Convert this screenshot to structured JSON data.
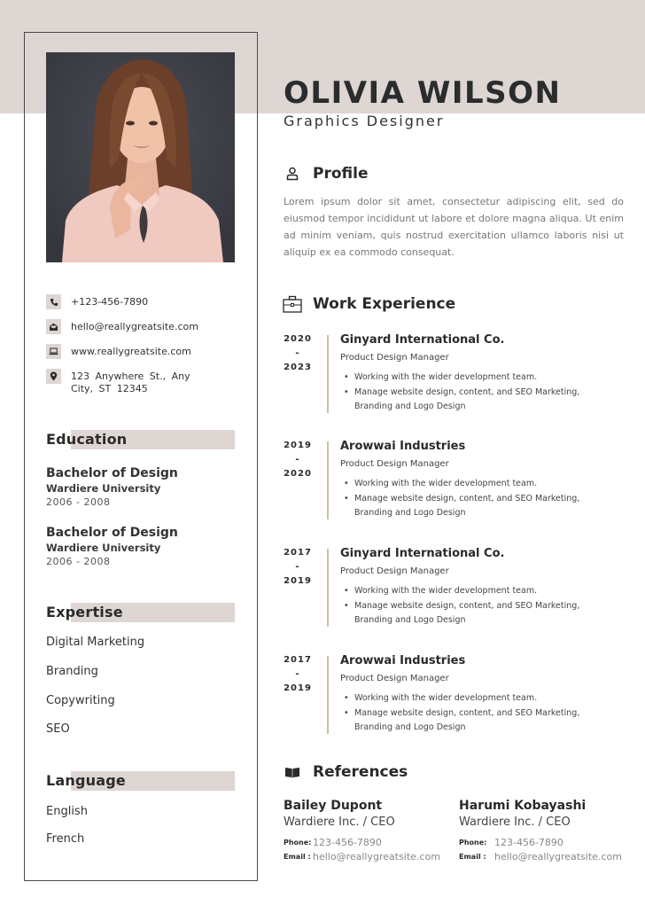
{
  "header": {
    "name": "OLIVIA WILSON",
    "title": "Graphics Designer"
  },
  "colors": {
    "band": "#ded6d3",
    "text_dark": "#2a2c2d",
    "timeline_line": "#cfbfa8",
    "photo_background": "#3e4049",
    "shirt": "#f0c9c0"
  },
  "photo": {
    "alt": "Portrait of Olivia Wilson"
  },
  "contact": {
    "phone": "+123-456-7890",
    "email": "hello@reallygreatsite.com",
    "website": "www.reallygreatsite.com",
    "address_line1": "123  Anywhere  St.,  Any",
    "address_line2": "City, ST 12345",
    "icons": [
      "phone-icon",
      "envelope-icon",
      "laptop-icon",
      "location-pin-icon"
    ]
  },
  "education": {
    "heading": "Education",
    "items": [
      {
        "degree": "Bachelor of Design",
        "school": "Wardiere University",
        "years": "2006 - 2008"
      },
      {
        "degree": "Bachelor of Design",
        "school": "Wardiere University",
        "years": "2006 - 2008"
      }
    ]
  },
  "expertise": {
    "heading": "Expertise",
    "items": [
      "Digital Marketing",
      "Branding",
      "Copywriting",
      "SEO"
    ]
  },
  "language": {
    "heading": "Language",
    "items": [
      "English",
      "French"
    ]
  },
  "profile": {
    "heading": "Profile",
    "icon": "user-icon",
    "text": "Lorem ipsum dolor sit amet, consectetur adipiscing elit, sed do eiusmod tempor incididunt ut labore et dolore magna aliqua. Ut enim ad minim veniam, quis nostrud exercitation ullamco laboris nisi ut aliquip ex ea commodo consequat."
  },
  "work": {
    "heading": "Work Experience",
    "icon": "briefcase-icon",
    "jobs": [
      {
        "start": "2020",
        "sep": "-",
        "end": "2023",
        "company": "Ginyard International Co.",
        "role": "Product Design Manager",
        "bullets": [
          "Working with the wider development team.",
          "Manage website design, content, and SEO Marketing, Branding and Logo Design"
        ]
      },
      {
        "start": "2019",
        "sep": "-",
        "end": "2020",
        "company": "Arowwai Industries",
        "role": "Product Design Manager",
        "bullets": [
          "Working with the wider development team.",
          "Manage website design, content, and SEO Marketing, Branding and Logo Design"
        ]
      },
      {
        "start": "2017",
        "sep": "-",
        "end": "2019",
        "company": "Ginyard International Co.",
        "role": "Product Design Manager",
        "bullets": [
          "Working with the wider development team.",
          "Manage website design, content, and SEO Marketing, Branding and Logo Design"
        ]
      },
      {
        "start": "2017",
        "sep": "-",
        "end": "2019",
        "company": "Arowwai Industries",
        "role": "Product Design Manager",
        "bullets": [
          "Working with the wider development team.",
          "Manage website design, content, and SEO Marketing, Branding and Logo Design"
        ]
      }
    ]
  },
  "references": {
    "heading": "References",
    "icon": "open-book-icon",
    "phone_label": "Phone:",
    "email_label": "Email :",
    "people": [
      {
        "name": "Bailey Dupont",
        "org": "Wardiere Inc. / CEO",
        "phone": "123-456-7890",
        "email": "hello@reallygreatsite.com"
      },
      {
        "name": "Harumi Kobayashi",
        "org": "Wardiere Inc. / CEO",
        "phone": "123-456-7890",
        "email": "hello@reallygreatsite.com"
      }
    ]
  }
}
